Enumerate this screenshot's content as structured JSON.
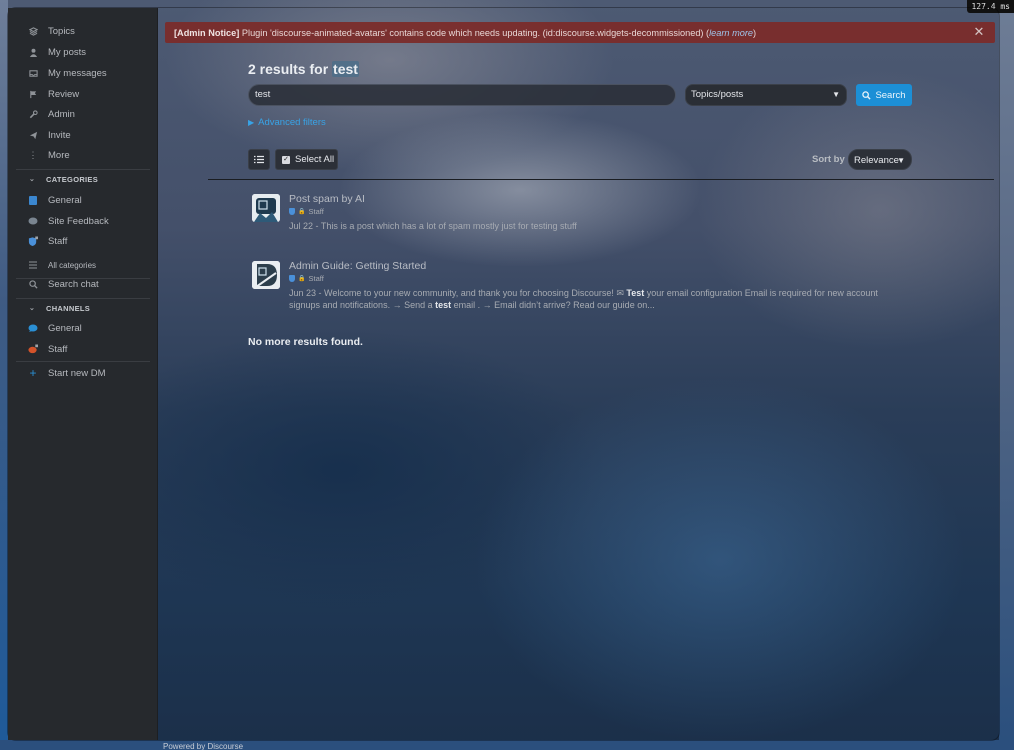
{
  "perf_badge": "127.4 ms",
  "sidebar": {
    "items": [
      {
        "label": "Topics",
        "icon": "layers-icon"
      },
      {
        "label": "My posts",
        "icon": "user-icon"
      },
      {
        "label": "My messages",
        "icon": "inbox-icon"
      },
      {
        "label": "Review",
        "icon": "flag-icon"
      },
      {
        "label": "Admin",
        "icon": "wrench-icon"
      },
      {
        "label": "Invite",
        "icon": "paper-plane-icon"
      },
      {
        "label": "More",
        "icon": "ellipsis-vertical-icon"
      }
    ],
    "categories_header": "CATEGORIES",
    "categories": [
      {
        "label": "General",
        "color": "#3b87d0"
      },
      {
        "label": "Site Feedback",
        "color": "#6e7882"
      },
      {
        "label": "Staff",
        "color": "#4a90d9"
      }
    ],
    "all_categories": "All categories",
    "search_chat": "Search chat",
    "channels_header": "CHANNELS",
    "channels": [
      {
        "label": "General",
        "color": "#2a8fd4"
      },
      {
        "label": "Staff",
        "color": "#d4532a"
      }
    ],
    "start_dm": "Start new DM"
  },
  "notice": {
    "prefix": "[Admin Notice]",
    "message": " Plugin 'discourse-animated-avatars' contains code which needs updating. (id:discourse.widgets-decommissioned) (",
    "link": "learn more",
    "suffix": ")"
  },
  "results": {
    "count_text": "2 results for ",
    "term": "test",
    "search_value": "test",
    "type_option": "Topics/posts",
    "search_button": "Search",
    "advanced_filters": "Advanced filters",
    "select_all": "Select All",
    "sort_label": "Sort by",
    "sort_value": "Relevance",
    "items": [
      {
        "title": "Post spam by AI",
        "category": "Staff",
        "date": "Jul 22",
        "blurb": " - This is a post which has a lot of spam mostly just for testing stuff"
      },
      {
        "title": "Admin Guide: Getting Started",
        "category": "Staff",
        "date": "Jun 23",
        "blurb_a": " - Welcome to your new community, and thank you for choosing Discourse! ",
        "blurb_bold": "Test",
        "blurb_b": " your email configuration Email is required for new account signups and notifications. → Send a ",
        "blurb_bold2": "test",
        "blurb_c": " email . → Email didn’t arrive? Read our guide on..."
      }
    ],
    "no_more": "No more results found."
  },
  "footer": {
    "powered_by": "Powered by Discourse"
  }
}
